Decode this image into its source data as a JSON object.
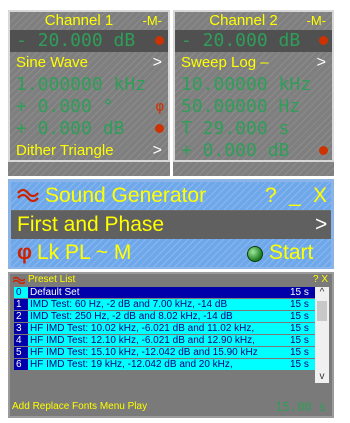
{
  "channel1": {
    "title": "Channel 1",
    "mode": "-M-",
    "level": "- 20.000 dB",
    "waveform": "Sine Wave",
    "frequency": "1.000000 kHz",
    "phase": "+ 0.000 °",
    "offset": "+ 0.000 dB",
    "dither": "Dither Triangle",
    "arrow": ">"
  },
  "channel2": {
    "title": "Channel 2",
    "mode": "-M-",
    "level": "- 20.000 dB",
    "waveform": "Sweep Log –",
    "start_freq": "10.00000 kHz",
    "stop_freq": "50.00000 Hz",
    "time": "T 29.000 s",
    "offset": "+ 0.000 dB",
    "arrow": ">"
  },
  "generator": {
    "title": "Sound Generator",
    "help": "?",
    "minimize": "_",
    "close": "X",
    "mode": "First and Phase",
    "mode_arrow": ">",
    "phi": "φ",
    "options": "Lk PL ~ M",
    "start": "Start"
  },
  "preset_list": {
    "title": "Preset List",
    "buttons": "? X",
    "rows": [
      {
        "n": "0",
        "desc": "Default Set",
        "dur": "15 s"
      },
      {
        "n": "1",
        "desc": "IMD Test: 60 Hz,  -2 dB and 7.00 kHz, -14 dB",
        "dur": "15 s"
      },
      {
        "n": "2",
        "desc": "IMD Test: 250 Hz, -2 dB and 8.02 kHz, -14 dB",
        "dur": "15 s"
      },
      {
        "n": "3",
        "desc": "HF IMD Test: 10.02 kHz, -6.021 dB and 11.02 kHz,",
        "dur": "15 s"
      },
      {
        "n": "4",
        "desc": "HF IMD Test: 12.10 kHz, -6.021 dB and 12.90 kHz,",
        "dur": "15 s"
      },
      {
        "n": "5",
        "desc": "HF IMD Test: 15.10 kHz, -12.042 dB and 15.90 kHz",
        "dur": "15 s"
      },
      {
        "n": "6",
        "desc": "HF IMD Test: 19 kHz,    -12.042 dB and 20 kHz,",
        "dur": "15 s"
      }
    ],
    "footer": "Add Replace Fonts Menu Play",
    "time": "15.00 s"
  },
  "colors": {
    "accent": "#ffff00",
    "value_green": "#2e9e58",
    "panel_blue": "#6fa8ea",
    "list_cyan": "#00ffff"
  }
}
